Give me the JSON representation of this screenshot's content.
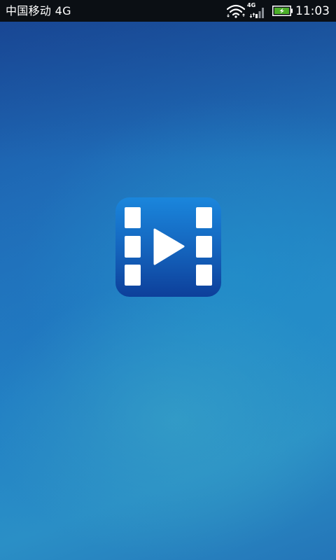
{
  "status_bar": {
    "carrier": "中国移动 4G",
    "network_label": "4G",
    "time": "11:03",
    "icons": [
      "wifi-icon",
      "signal-icon",
      "battery-charging-icon"
    ]
  },
  "splash": {
    "icon": "video-play-icon",
    "colors": {
      "icon_top": "#1a86dc",
      "icon_bottom": "#0d3f9a",
      "icon_glyph": "#ffffff",
      "status_bar_bg": "#0b0f14",
      "battery_fill": "#4caf2a"
    }
  }
}
